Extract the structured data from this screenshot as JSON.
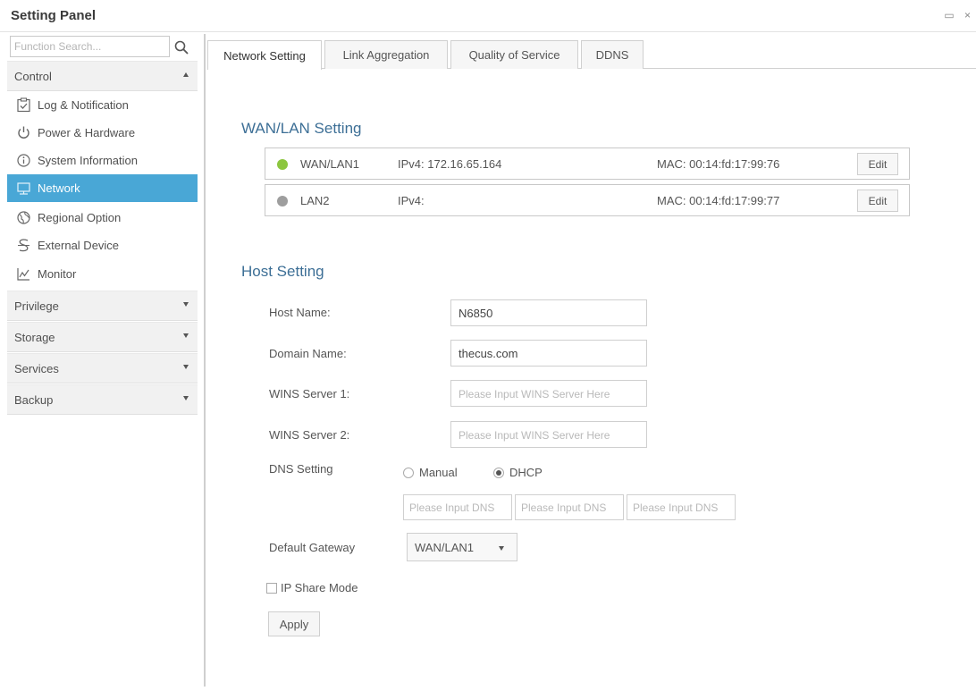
{
  "window": {
    "title": "Setting Panel",
    "controls": "▭ ×"
  },
  "sidebar": {
    "search_placeholder": "Function Search...",
    "groups": [
      {
        "label": "Control",
        "expanded": true
      },
      {
        "label": "Privilege",
        "expanded": false
      },
      {
        "label": "Storage",
        "expanded": false
      },
      {
        "label": "Services",
        "expanded": false
      },
      {
        "label": "Backup",
        "expanded": false
      }
    ],
    "items": [
      {
        "label": "Log & Notification",
        "icon": "log-notification-icon"
      },
      {
        "label": "Power & Hardware",
        "icon": "power-icon"
      },
      {
        "label": "System Information",
        "icon": "info-icon"
      },
      {
        "label": "Network",
        "icon": "network-icon",
        "active": true
      },
      {
        "label": "Regional Option",
        "icon": "globe-icon"
      },
      {
        "label": "External Device",
        "icon": "external-device-icon"
      },
      {
        "label": "Monitor",
        "icon": "monitor-chart-icon"
      }
    ]
  },
  "tabs": [
    {
      "label": "Network Setting",
      "active": true
    },
    {
      "label": "Link Aggregation"
    },
    {
      "label": "Quality of Service"
    },
    {
      "label": "DDNS"
    }
  ],
  "wanlan": {
    "title": "WAN/LAN Setting",
    "rows": [
      {
        "name": "WAN/LAN1",
        "ip": "IPv4: 172.16.65.164",
        "mac": "MAC: 00:14:fd:17:99:76",
        "status_color": "#8cc63f",
        "edit": "Edit"
      },
      {
        "name": "LAN2",
        "ip": "IPv4:",
        "mac": "MAC: 00:14:fd:17:99:77",
        "status_color": "#9e9e9e",
        "edit": "Edit"
      }
    ]
  },
  "host": {
    "title": "Host Setting",
    "host_name_label": "Host Name:",
    "host_name_value": "N6850",
    "domain_name_label": "Domain Name:",
    "domain_name_value": "thecus.com",
    "wins1_label": "WINS Server 1:",
    "wins1_placeholder": "Please Input WINS Server Here",
    "wins2_label": "WINS Server 2:",
    "wins2_placeholder": "Please Input WINS Server Here",
    "dns_label": "DNS Setting",
    "dns_manual": "Manual",
    "dns_dhcp": "DHCP",
    "dns_selected": "DHCP",
    "dns_placeholder": "Please Input DNS",
    "gateway_label": "Default Gateway",
    "gateway_value": "WAN/LAN1",
    "ip_share_label": "IP Share Mode",
    "apply_label": "Apply"
  },
  "colors": {
    "accent": "#49a7d6",
    "section_title": "#3d6f96"
  }
}
